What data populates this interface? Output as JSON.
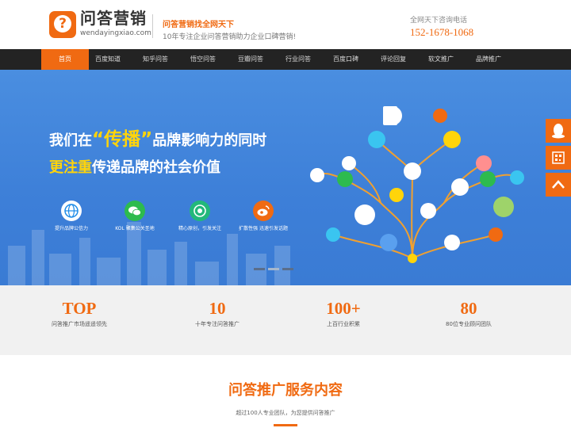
{
  "header": {
    "logo_cn": "问答营销",
    "logo_en": "wendayingxiao.com",
    "logo_mark": "?",
    "slogan_main": "问答营销找全网天下",
    "slogan_sub": "10年专注企业问答营销助力企业口碑营销!",
    "hotline_label": "全网天下咨询电话",
    "hotline_number": "152-1678-1068"
  },
  "nav": {
    "items": [
      {
        "label": "首页",
        "active": true
      },
      {
        "label": "百度知道",
        "active": false
      },
      {
        "label": "知乎问答",
        "active": false
      },
      {
        "label": "悟空问答",
        "active": false
      },
      {
        "label": "豆瓣问答",
        "active": false
      },
      {
        "label": "行业问答",
        "active": false
      },
      {
        "label": "百度口碑",
        "active": false
      },
      {
        "label": "评论回复",
        "active": false
      },
      {
        "label": "软文推广",
        "active": false
      },
      {
        "label": "品牌推广",
        "active": false
      }
    ]
  },
  "banner": {
    "line1_pre": "我们在",
    "line1_hl": "“传播”",
    "line1_post": "品牌影响力的同时",
    "line2_hl": "更注重",
    "line2_post": "传递品牌的社会价值",
    "features": [
      {
        "caption": "提升品牌公信力",
        "icon": "globe-icon",
        "color": "#1d8be8"
      },
      {
        "caption": "KOL 聚集公关圣地",
        "icon": "wechat-icon",
        "color": "#2dbb4e"
      },
      {
        "caption": "精心原创，引发关注",
        "icon": "target-icon",
        "color": "#22b87a"
      },
      {
        "caption": "扩散性强 迅速引发话题",
        "icon": "weibo-icon",
        "color": "#f06a12"
      }
    ],
    "slides": 3,
    "active_slide": 1
  },
  "side_float": [
    "qq-icon",
    "qrcode-icon",
    "back-to-top-icon"
  ],
  "stats": [
    {
      "num": "TOP",
      "label": "问答推广市场遥遥领先"
    },
    {
      "num": "10",
      "label": "十年专注问答推广"
    },
    {
      "num": "100+",
      "label": "上百行业积累"
    },
    {
      "num": "80",
      "label": "80位专业顾问团队"
    }
  ],
  "services": {
    "title": "问答推广服务内容",
    "subtitle": "超过100人专业团队，为您提供问答推广"
  },
  "colors": {
    "accent": "#f06a12",
    "nav_bg": "#232323",
    "banner_blue": "#3d7fd8",
    "highlight": "#ffd40a"
  }
}
